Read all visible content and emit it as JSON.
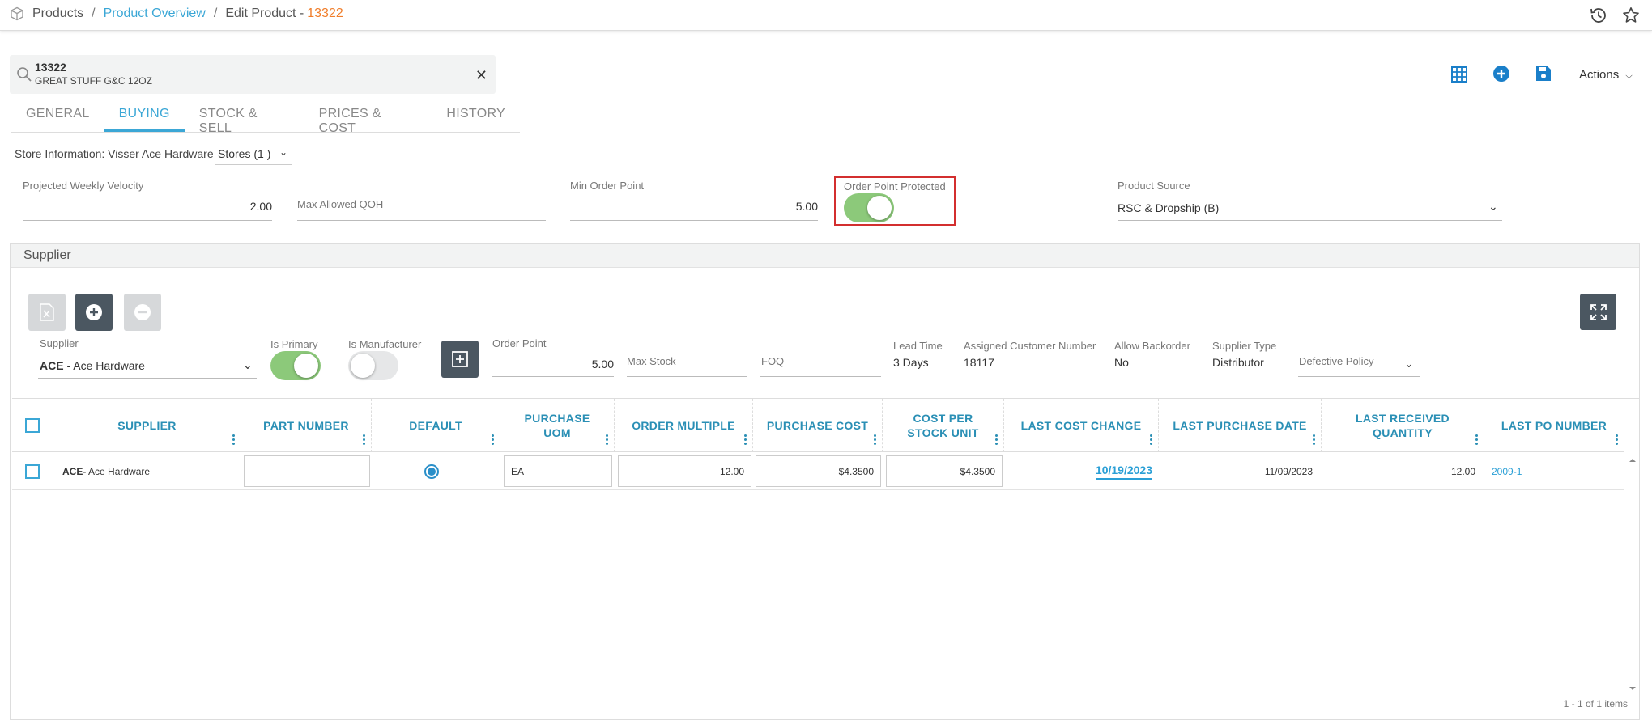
{
  "breadcrumb": {
    "root": "Products",
    "sep": "/",
    "overview": "Product Overview",
    "current": "Edit Product -",
    "number": "13322"
  },
  "product": {
    "number": "13322",
    "description": "GREAT STUFF G&C 12OZ"
  },
  "header_actions": {
    "actions_label": "Actions"
  },
  "tabs": [
    {
      "label": "GENERAL",
      "active": false
    },
    {
      "label": "BUYING",
      "active": true
    },
    {
      "label": "STOCK & SELL",
      "active": false
    },
    {
      "label": "PRICES & COST",
      "active": false
    },
    {
      "label": "HISTORY",
      "active": false
    }
  ],
  "store": {
    "info": "Store Information: Visser Ace Hardware",
    "stores_select": "Stores  (1 )"
  },
  "buying": {
    "projected_weekly_velocity_label": "Projected Weekly Velocity",
    "projected_weekly_velocity": "2.00",
    "max_allowed_qoh_label": "Max Allowed QOH",
    "min_order_point_label": "Min Order Point",
    "min_order_point": "5.00",
    "order_point_protected_label": "Order Point Protected",
    "order_point_protected": true,
    "product_source_label": "Product Source",
    "product_source": "RSC & Dropship (B)"
  },
  "supplier": {
    "section_title": "Supplier",
    "supplier_label": "Supplier",
    "supplier_code": "ACE",
    "supplier_name": " - Ace Hardware",
    "is_primary_label": "Is Primary",
    "is_primary": true,
    "is_manufacturer_label": "Is Manufacturer",
    "is_manufacturer": false,
    "order_point_label": "Order Point",
    "order_point": "5.00",
    "max_stock_label": "Max Stock",
    "foq_label": "FOQ",
    "lead_time_label": "Lead Time",
    "lead_time": "3  Days",
    "assigned_customer_number_label": "Assigned Customer Number",
    "assigned_customer_number": "18117",
    "allow_backorder_label": "Allow Backorder",
    "allow_backorder": "No",
    "supplier_type_label": "Supplier Type",
    "supplier_type": "Distributor",
    "defective_policy_label": "Defective Policy"
  },
  "grid": {
    "columns": [
      {
        "label": "SUPPLIER"
      },
      {
        "label": "PART NUMBER"
      },
      {
        "label": "DEFAULT"
      },
      {
        "label": "PURCHASE UOM"
      },
      {
        "label": "ORDER MULTIPLE"
      },
      {
        "label": "PURCHASE COST"
      },
      {
        "label": "COST PER STOCK UNIT"
      },
      {
        "label": "LAST COST CHANGE"
      },
      {
        "label": "LAST PURCHASE DATE"
      },
      {
        "label": "LAST RECEIVED QUANTITY"
      },
      {
        "label": "LAST PO NUMBER"
      }
    ],
    "rows": [
      {
        "supplier_code": "ACE",
        "supplier_name": " - Ace Hardware",
        "part_number": "",
        "default": true,
        "purchase_uom": "EA",
        "order_multiple": "12.00",
        "purchase_cost": "$4.3500",
        "cost_per_stock_unit": "$4.3500",
        "last_cost_change": "10/19/2023",
        "last_purchase_date": "11/09/2023",
        "last_received_quantity": "12.00",
        "last_po_number": "2009-1"
      }
    ],
    "footer": "1 - 1 of 1 items"
  },
  "colors": {
    "accent": "#3ba7d6",
    "header_text": "#2a8fb5",
    "toggle_on": "#8cc97a",
    "highlight": "#d32f2f",
    "dark_button": "#4b5761",
    "product_number": "#f07d2a"
  }
}
